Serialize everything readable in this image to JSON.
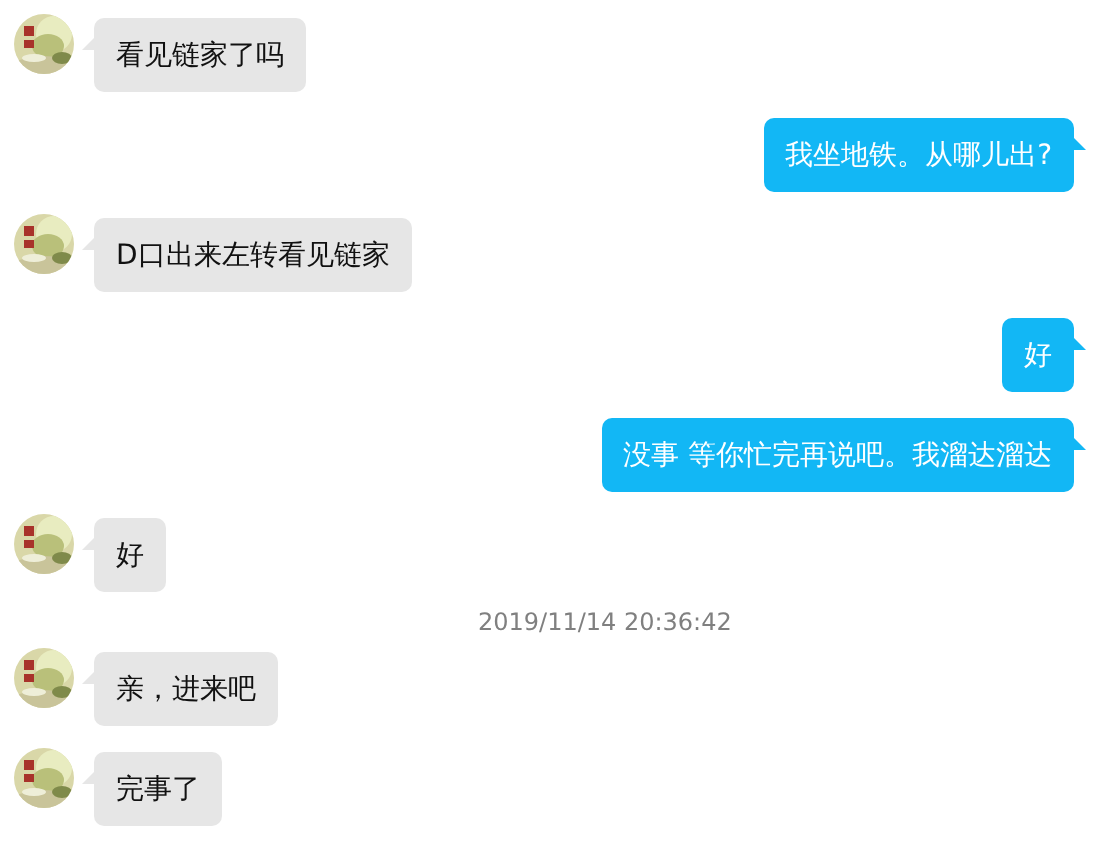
{
  "messages": [
    {
      "kind": "received",
      "text": "看见链家了吗"
    },
    {
      "kind": "sent",
      "text": "我坐地铁。从哪儿出?"
    },
    {
      "kind": "received",
      "text": "D口出来左转看见链家"
    },
    {
      "kind": "sent",
      "text": "好"
    },
    {
      "kind": "sent",
      "text": "没事 等你忙完再说吧。我溜达溜达"
    },
    {
      "kind": "received",
      "text": "好"
    },
    {
      "kind": "timestamp",
      "text": "2019/11/14 20:36:42"
    },
    {
      "kind": "received",
      "text": "亲，进来吧"
    },
    {
      "kind": "received",
      "text": "完事了"
    }
  ]
}
